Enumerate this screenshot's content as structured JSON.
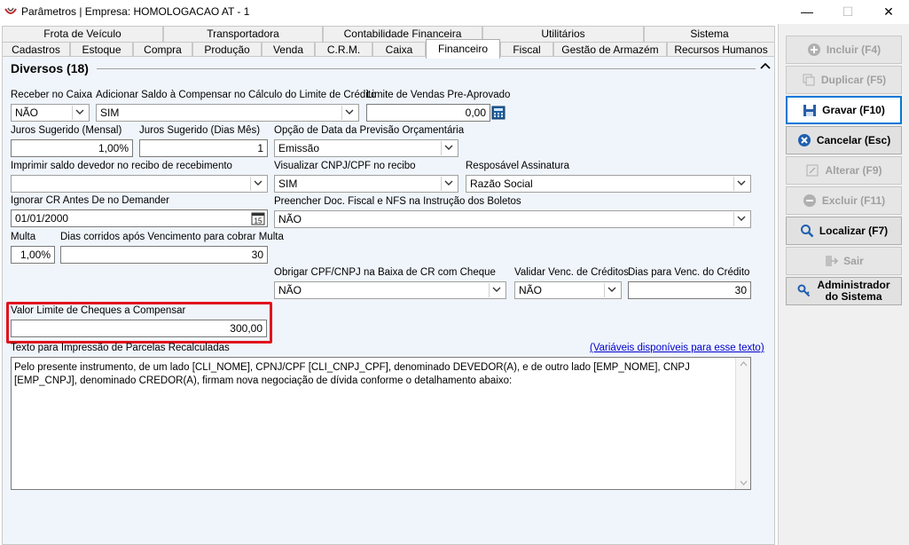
{
  "window": {
    "title": "Parâmetros | Empresa: HOMOLOGACAO AT - 1",
    "minimize": "—",
    "maximize": "☐",
    "close": "✕"
  },
  "tabs_row1": [
    "Frota de Veículo",
    "Transportadora",
    "Contabilidade Financeira",
    "Utilitários",
    "Sistema"
  ],
  "tabs_row2": [
    "Cadastros",
    "Estoque",
    "Compra",
    "Produção",
    "Venda",
    "C.R.M.",
    "Caixa",
    "Financeiro",
    "Fiscal",
    "Gestão de Armazém",
    "Recursos Humanos"
  ],
  "active_tab": "Financeiro",
  "section": {
    "title": "Diversos (18)",
    "collapse_glyph": "︿"
  },
  "fields": {
    "receber_caixa": {
      "label": "Receber no Caixa",
      "value": "NÃO"
    },
    "adicionar_saldo": {
      "label": "Adicionar Saldo à Compensar no Cálculo do Limite de Crédito",
      "value": "SIM"
    },
    "limite_vendas": {
      "label": "Limite de Vendas Pre-Aprovado",
      "value": "0,00"
    },
    "juros_mensal": {
      "label": "Juros Sugerido (Mensal)",
      "value": "1,00%"
    },
    "juros_dias": {
      "label": "Juros Sugerido (Dias Mês)",
      "value": "1"
    },
    "opcao_data": {
      "label": "Opção de Data da Previsão Orçamentária",
      "value": "Emissão"
    },
    "imprimir_saldo": {
      "label": "Imprimir saldo devedor no recibo de recebimento",
      "value": ""
    },
    "visualizar_cnpj": {
      "label": "Visualizar CNPJ/CPF no recibo",
      "value": "SIM"
    },
    "responsavel": {
      "label": "Resposável Assinatura",
      "value": "Razão Social"
    },
    "ignorar_cr": {
      "label": "Ignorar CR Antes De no Demander",
      "value": "01/01/2000"
    },
    "preencher_doc": {
      "label": "Preencher Doc. Fiscal e NFS na Instrução dos Boletos",
      "value": "NÃO"
    },
    "multa": {
      "label": "Multa",
      "value": "1,00%"
    },
    "dias_multa": {
      "label": "Dias corridos após Vencimento para cobrar Multa",
      "value": "30"
    },
    "obrigar_cpf": {
      "label": "Obrigar CPF/CNPJ na Baixa de CR com Cheque",
      "value": "NÃO"
    },
    "validar_venc": {
      "label": "Validar Venc. de Créditos",
      "value": "NÃO"
    },
    "dias_venc": {
      "label": "Dias para Venc. do Crédito",
      "value": "30"
    },
    "valor_cheques": {
      "label": "Valor Limite de Cheques a Compensar",
      "value": "300,00"
    },
    "texto_parcelas": {
      "label": "Texto para Impressão de Parcelas Recalculadas",
      "link": "(Variáveis disponíveis para esse texto)",
      "value": "Pelo presente instrumento, de um lado [CLI_NOME], CPNJ/CPF [CLI_CNPJ_CPF], denominado DEVEDOR(A), e de outro lado [EMP_NOME], CNPJ [EMP_CNPJ], denominado CREDOR(A), firmam nova negociação de dívida conforme o detalhamento abaixo:"
    }
  },
  "buttons": {
    "incluir": "Incluir (F4)",
    "duplicar": "Duplicar (F5)",
    "gravar": "Gravar (F10)",
    "cancelar": "Cancelar (Esc)",
    "alterar": "Alterar (F9)",
    "excluir": "Excluir (F11)",
    "localizar": "Localizar (F7)",
    "sair": "Sair",
    "admin_line1": "Administrador",
    "admin_line2": "do Sistema"
  },
  "colors": {
    "highlight_border": "#e0141e",
    "focus_border": "#0078d7",
    "link": "#0000cc"
  }
}
